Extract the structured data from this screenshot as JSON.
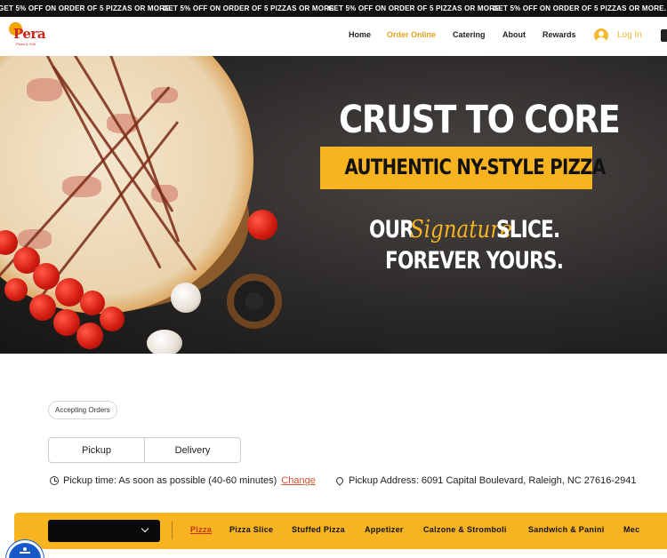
{
  "promo": {
    "messages": [
      "GET 5% OFF ON ORDER OF 5 PIZZAS OR MORE.",
      "GET 5% OFF ON ORDER OF 5 PIZZAS OR MORE.",
      "GET 5% OFF ON ORDER OF 5 PIZZAS OR MORE.",
      "GET 5% OFF ON ORDER OF 5 PIZZAS OR MORE."
    ]
  },
  "header": {
    "logo_text": "Pera",
    "logo_tagline": "Pizza & Grill",
    "nav": [
      {
        "label": "Home"
      },
      {
        "label": "Order Online",
        "active": true
      },
      {
        "label": "Catering"
      },
      {
        "label": "About"
      },
      {
        "label": "Rewards"
      }
    ],
    "login_label": "Log In"
  },
  "hero": {
    "title": "CRUST TO CORE",
    "band": "AUTHENTIC NY-STYLE PIZZA",
    "line1_a": "OUR",
    "line1_script": "Signature",
    "line1_b": "SLICE.",
    "line2": "FOREVER YOURS."
  },
  "order": {
    "status_badge": "Accepting Orders",
    "modes": [
      "Pickup",
      "Delivery"
    ],
    "pickup_time": "Pickup time: As soon as possible (40-60 minutes)",
    "change_label": "Change",
    "pickup_address": "Pickup Address: 6091 Capital Boulevard, Raleigh, NC 27616-2941"
  },
  "categories": {
    "items": [
      "Pizza",
      "Pizza Slice",
      "Stuffed Pizza",
      "Appetizer",
      "Calzone & Stromboli",
      "Sandwich & Panini",
      "Mec"
    ],
    "active": "Pizza"
  },
  "colors": {
    "accent": "#f7b320",
    "nav_active": "#e8a21b",
    "link": "#d0552c",
    "ticker_bg": "#111111",
    "a11y": "#1559c9"
  },
  "icons": [
    "user-icon",
    "cart-icon",
    "clock-icon",
    "location-pin-icon",
    "chevron-down-icon",
    "accessibility-icon"
  ]
}
